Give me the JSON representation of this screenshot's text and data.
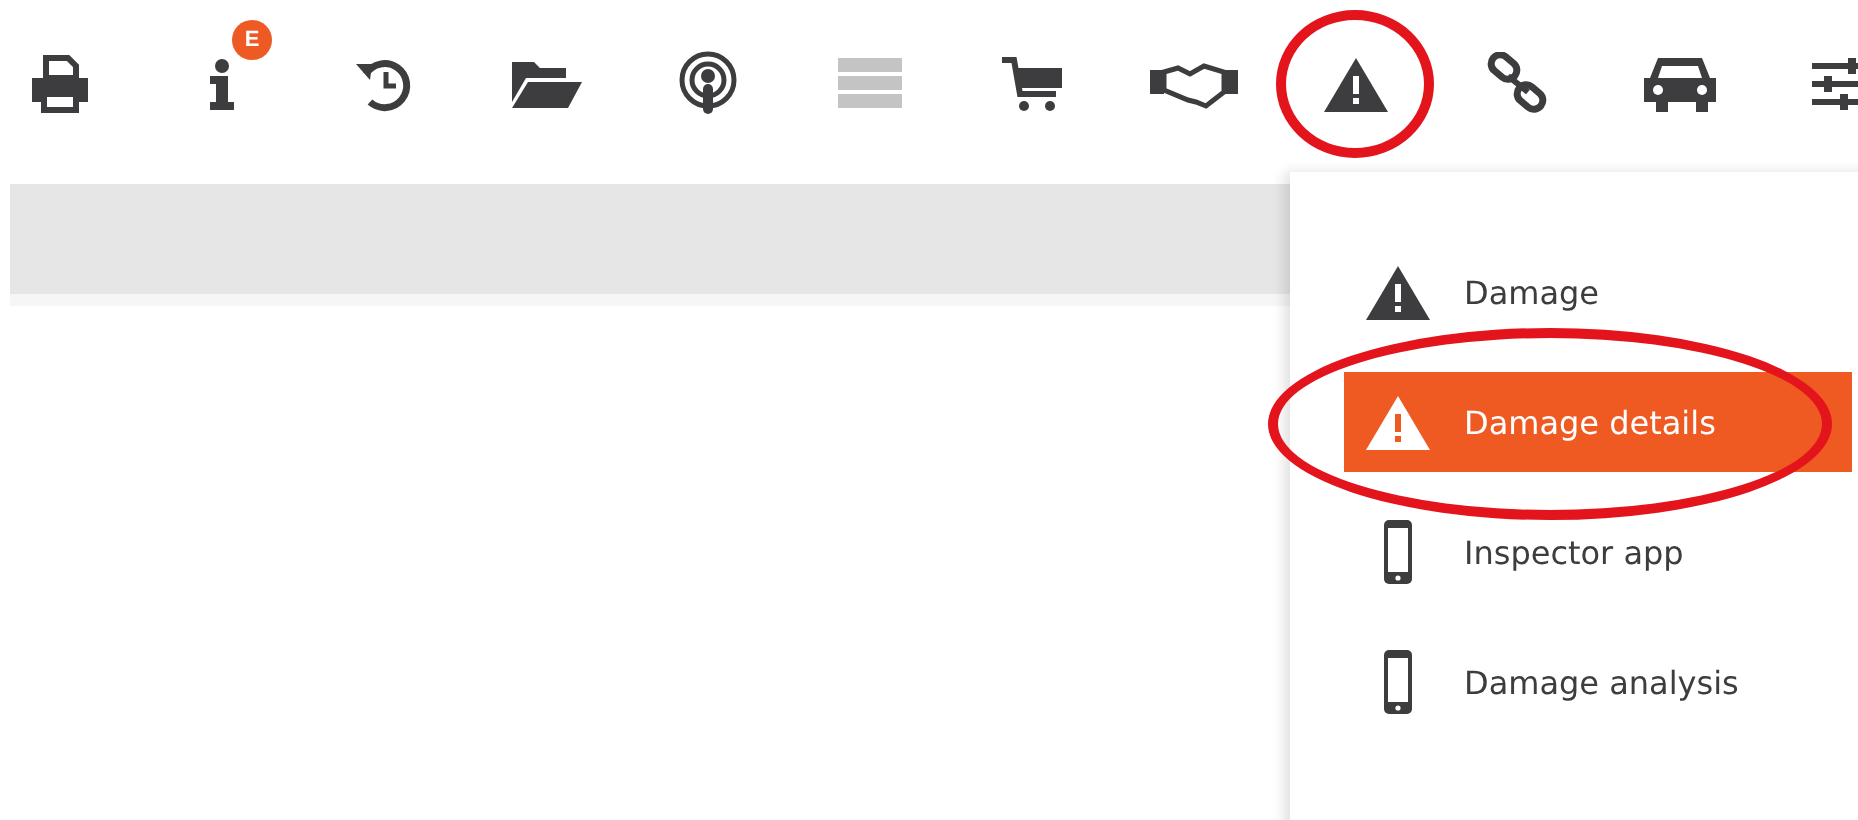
{
  "toolbar": [
    {
      "kind": "printer",
      "disabled": false,
      "selected": false
    },
    {
      "kind": "info",
      "disabled": false,
      "selected": false,
      "badge": "E"
    },
    {
      "kind": "history",
      "disabled": false,
      "selected": false
    },
    {
      "kind": "folder",
      "disabled": false,
      "selected": false
    },
    {
      "kind": "podcast",
      "disabled": false,
      "selected": false
    },
    {
      "kind": "server",
      "disabled": true,
      "selected": false
    },
    {
      "kind": "cart",
      "disabled": false,
      "selected": false
    },
    {
      "kind": "handshake",
      "disabled": false,
      "selected": false
    },
    {
      "kind": "warning",
      "disabled": false,
      "selected": true
    },
    {
      "kind": "link",
      "disabled": false,
      "selected": false
    },
    {
      "kind": "car",
      "disabled": false,
      "selected": false
    },
    {
      "kind": "sliders",
      "disabled": false,
      "selected": false
    }
  ],
  "menu": [
    {
      "kind": "warning",
      "label": "Damage",
      "selected": false
    },
    {
      "kind": "warning",
      "label": "Damage details",
      "selected": true
    },
    {
      "kind": "phone",
      "label": "Inspector app",
      "selected": false
    },
    {
      "kind": "phone",
      "label": "Damage analysis",
      "selected": false
    }
  ]
}
